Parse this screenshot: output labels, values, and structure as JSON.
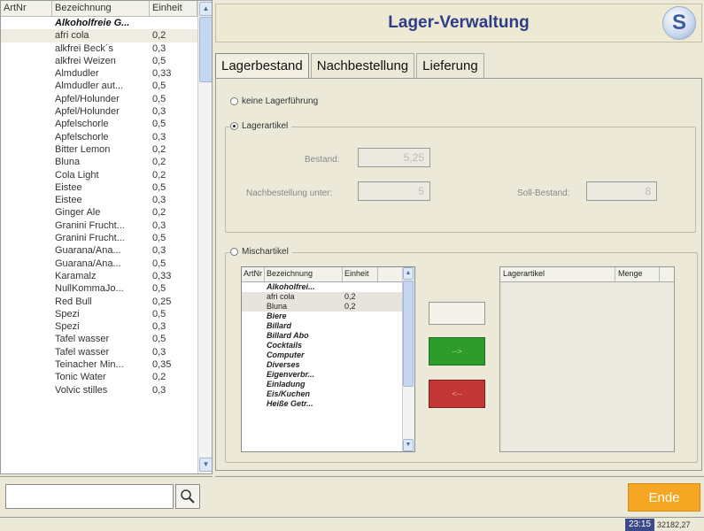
{
  "list": {
    "headers": [
      "ArtNr",
      "Bezeichnung",
      "Einheit"
    ],
    "rows": [
      {
        "name": "Alkoholfreie G...",
        "unit": "",
        "group": true
      },
      {
        "name": "afri cola",
        "unit": "0,2",
        "selected": true
      },
      {
        "name": "alkfrei Beck´s",
        "unit": "0,3"
      },
      {
        "name": "alkfrei Weizen",
        "unit": "0,5"
      },
      {
        "name": "Almdudler",
        "unit": "0,33"
      },
      {
        "name": "Almdudler aut...",
        "unit": "0,5"
      },
      {
        "name": "Apfel/Holunder",
        "unit": "0,5"
      },
      {
        "name": "Apfel/Holunder",
        "unit": "0,3"
      },
      {
        "name": "Apfelschorle",
        "unit": "0,5"
      },
      {
        "name": "Apfelschorle",
        "unit": "0,3"
      },
      {
        "name": "Bitter Lemon",
        "unit": "0,2"
      },
      {
        "name": "Bluna",
        "unit": "0,2"
      },
      {
        "name": "Cola Light",
        "unit": "0,2"
      },
      {
        "name": "Eistee",
        "unit": "0,5"
      },
      {
        "name": "Eistee",
        "unit": "0,3"
      },
      {
        "name": "Ginger Ale",
        "unit": "0,2"
      },
      {
        "name": "Granini Frucht...",
        "unit": "0,3"
      },
      {
        "name": "Granini Frucht...",
        "unit": "0,5"
      },
      {
        "name": "Guarana/Ana...",
        "unit": "0,3"
      },
      {
        "name": "Guarana/Ana...",
        "unit": "0,5"
      },
      {
        "name": "Karamalz",
        "unit": "0,33"
      },
      {
        "name": "NullKommaJo...",
        "unit": "0,5"
      },
      {
        "name": "Red Bull",
        "unit": "0,25"
      },
      {
        "name": "Spezi",
        "unit": "0,5"
      },
      {
        "name": "Spezi",
        "unit": "0,3"
      },
      {
        "name": "Tafel wasser",
        "unit": "0,5"
      },
      {
        "name": "Tafel wasser",
        "unit": "0,3"
      },
      {
        "name": "Teinacher Min...",
        "unit": "0,35"
      },
      {
        "name": "Tonic Water",
        "unit": "0,2"
      },
      {
        "name": "Volvic stilles",
        "unit": "0,3"
      }
    ]
  },
  "search": {
    "placeholder": ""
  },
  "header": {
    "title": "Lager-Verwaltung",
    "logo": "S"
  },
  "tabs": [
    "Lagerbestand",
    "Nachbestellung",
    "Lieferung"
  ],
  "options": {
    "keine": "keine Lagerführung",
    "lager": "Lagerartikel",
    "misch": "Mischartikel"
  },
  "fields": {
    "bestand_label": "Bestand:",
    "bestand_value": "5,25",
    "nach_label": "Nachbestellung unter:",
    "nach_value": "5",
    "soll_label": "Soll-Bestand:",
    "soll_value": "8"
  },
  "inner": {
    "headers": [
      "ArtNr",
      "Bezeichnung",
      "Einheit"
    ],
    "rows": [
      {
        "name": "Alkoholfrei...",
        "unit": "",
        "group": true
      },
      {
        "name": "afri cola",
        "unit": "0,2",
        "selected": true
      },
      {
        "name": "Bluna",
        "unit": "0,2",
        "selected": true
      },
      {
        "name": "Biere",
        "unit": "",
        "group": true
      },
      {
        "name": "Billard",
        "unit": "",
        "group": true
      },
      {
        "name": "Billard Abo",
        "unit": "",
        "group": true
      },
      {
        "name": "Cocktails",
        "unit": "",
        "group": true
      },
      {
        "name": "Computer",
        "unit": "",
        "group": true
      },
      {
        "name": "Diverses",
        "unit": "",
        "group": true
      },
      {
        "name": "Eigenverbr...",
        "unit": "",
        "group": true
      },
      {
        "name": "Einladung",
        "unit": "",
        "group": true
      },
      {
        "name": "Eis/Kuchen",
        "unit": "",
        "group": true
      },
      {
        "name": "Heiße Getr...",
        "unit": "",
        "group": true
      }
    ]
  },
  "right_grid": {
    "headers": [
      "Lagerartikel",
      "Menge"
    ]
  },
  "buttons": {
    "add": "-->",
    "remove": "<--",
    "ende": "Ende"
  },
  "status": {
    "time": "23:15",
    "number": "32182,27"
  },
  "colors": {
    "add": "#2e9c2a",
    "remove": "#c23636",
    "ende": "#f5a623",
    "title": "#2d3d88"
  }
}
